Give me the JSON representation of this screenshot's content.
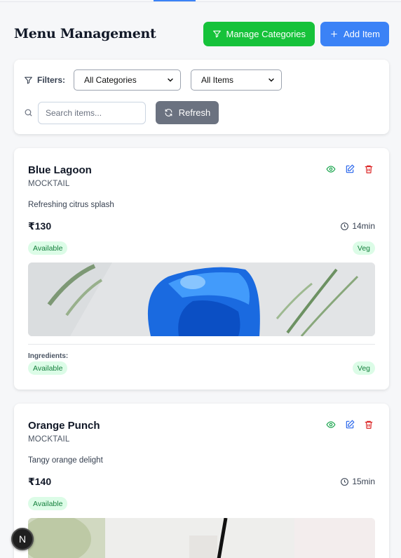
{
  "header": {
    "title": "Menu Management",
    "manage_categories_label": "Manage Categories",
    "add_item_label": "Add Item"
  },
  "filters": {
    "label": "Filters:",
    "category_select": "All Categories",
    "items_select": "All Items",
    "search_placeholder": "Search items...",
    "refresh_label": "Refresh"
  },
  "items": [
    {
      "name": "Blue Lagoon",
      "category": "MOCKTAIL",
      "description": "Refreshing citrus splash",
      "price": "₹130",
      "time": "14min",
      "availability": "Available",
      "diet": "Veg",
      "ingredients_label": "Ingredients:",
      "footer_availability": "Available",
      "footer_diet": "Veg"
    },
    {
      "name": "Orange Punch",
      "category": "MOCKTAIL",
      "description": "Tangy orange delight",
      "price": "₹140",
      "time": "15min",
      "availability": "Available"
    }
  ],
  "fab_letter": "N",
  "colors": {
    "green_button": "#16c23a",
    "blue_button": "#3b82f6",
    "badge_bg": "#dcfce7",
    "badge_text": "#15803d",
    "refresh_button": "#6b7280"
  }
}
